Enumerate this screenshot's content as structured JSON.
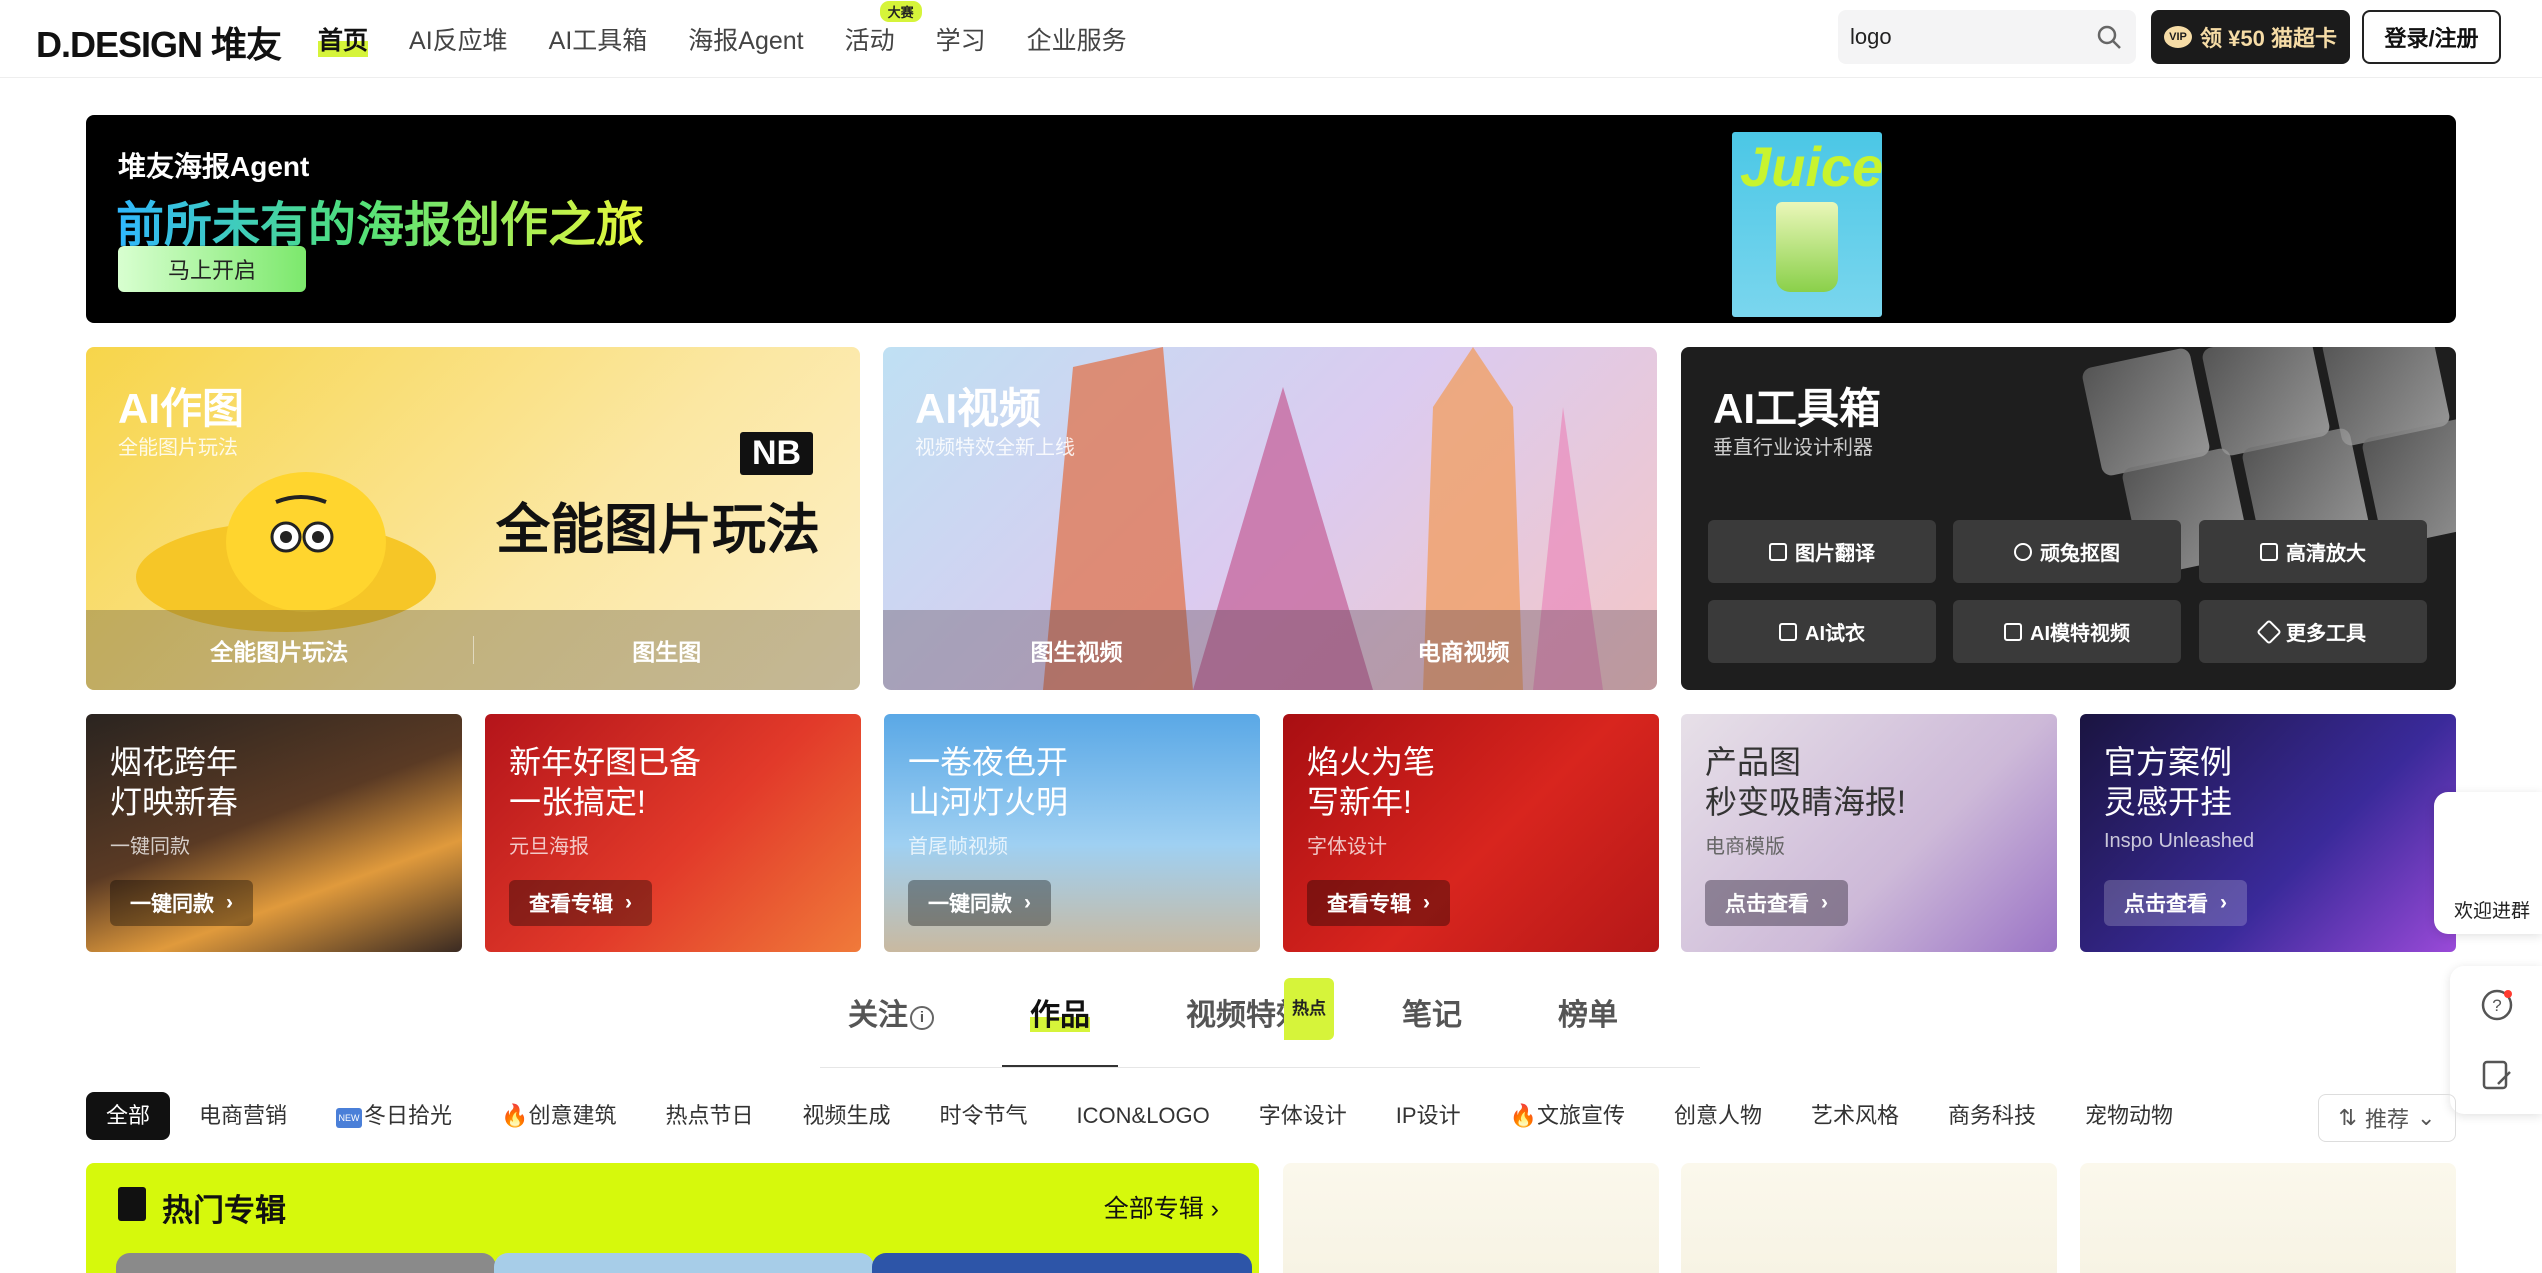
{
  "header": {
    "logo": "D.DESIGN 堆友",
    "nav": [
      {
        "label": "首页",
        "active": true
      },
      {
        "label": "AI反应堆"
      },
      {
        "label": "AI工具箱"
      },
      {
        "label": "海报Agent"
      },
      {
        "label": "活动",
        "badge": "大赛"
      },
      {
        "label": "学习"
      },
      {
        "label": "企业服务"
      }
    ],
    "search_value": "logo",
    "vip_icon_text": "VIP",
    "vip_label": "领 ¥50 猫超卡",
    "login_label": "登录/注册"
  },
  "banner": {
    "title": "堆友海报Agent",
    "subtitle": "前所未有的海报创作之旅",
    "button": "马上开启",
    "poster_word": "Juice"
  },
  "features": {
    "ai_image": {
      "title": "AI作图",
      "subtitle": "全能图片玩法",
      "tag": "NB",
      "headline": "全能图片玩法",
      "actions": [
        "全能图片玩法",
        "图生图"
      ]
    },
    "ai_video": {
      "title": "AI视频",
      "subtitle": "视频特效全新上线",
      "actions": [
        "图生视频",
        "电商视频"
      ]
    },
    "ai_tools": {
      "title": "AI工具箱",
      "subtitle": "垂直行业设计利器",
      "tools": [
        "图片翻译",
        "顽兔抠图",
        "高清放大",
        "AI试衣",
        "AI模特视频",
        "更多工具"
      ]
    }
  },
  "promo_cards": [
    {
      "title": "烟花跨年\n灯映新春",
      "sub": "一键同款",
      "button": "一键同款"
    },
    {
      "title": "新年好图已备\n一张搞定!",
      "sub": "元旦海报",
      "button": "查看专辑"
    },
    {
      "title": "一卷夜色开\n山河灯火明",
      "sub": "首尾帧视频",
      "button": "一键同款"
    },
    {
      "title": "焰火为笔\n写新年!",
      "sub": "字体设计",
      "button": "查看专辑"
    },
    {
      "title": "产品图\n秒变吸睛海报!",
      "sub": "电商模版",
      "button": "点击查看"
    },
    {
      "title": "官方案例\n灵感开挂",
      "sub": "Inspo Unleashed",
      "button": "点击查看"
    }
  ],
  "side": {
    "welcome": "欢迎进群"
  },
  "tabs": [
    {
      "label": "关注",
      "info": "i"
    },
    {
      "label": "作品",
      "active": true
    },
    {
      "label": "视频特效",
      "badge": "热点"
    },
    {
      "label": "笔记"
    },
    {
      "label": "榜单"
    }
  ],
  "categories": [
    "全部",
    "电商营销",
    "冬日拾光",
    "创意建筑",
    "热点节日",
    "视频生成",
    "时令节气",
    "ICON&LOGO",
    "字体设计",
    "IP设计",
    "文旅宣传",
    "创意人物",
    "艺术风格",
    "商务科技",
    "宠物动物"
  ],
  "sort_label": "推荐",
  "hot_albums": {
    "title": "热门专辑",
    "all": "全部专辑"
  }
}
